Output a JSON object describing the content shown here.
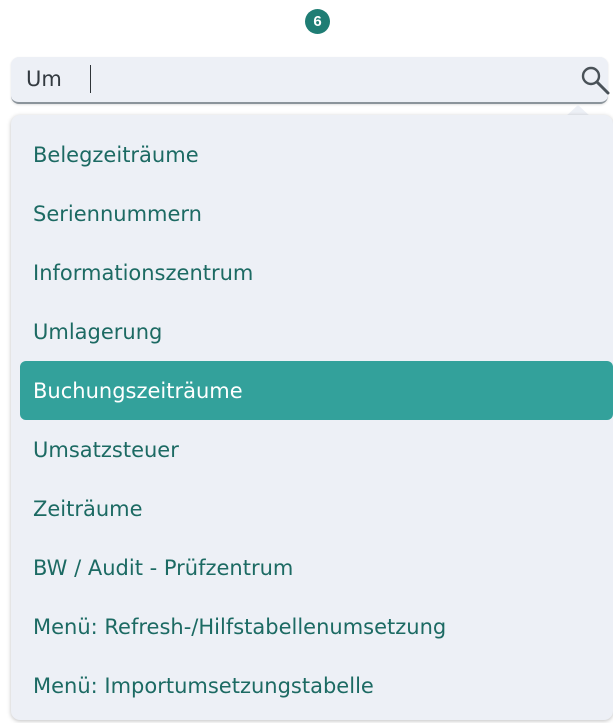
{
  "step_badge": "6",
  "search": {
    "value": "Um",
    "icon": "search-icon"
  },
  "results": [
    {
      "label": "Belegzeiträume",
      "selected": false
    },
    {
      "label": "Seriennummern",
      "selected": false
    },
    {
      "label": "Informationszentrum",
      "selected": false
    },
    {
      "label": "Umlagerung",
      "selected": false
    },
    {
      "label": "Buchungszeiträume",
      "selected": true
    },
    {
      "label": "Umsatzsteuer",
      "selected": false
    },
    {
      "label": "Zeiträume",
      "selected": false
    },
    {
      "label": "BW / Audit - Prüfzentrum",
      "selected": false
    },
    {
      "label": "Menü: Refresh-/Hilfstabellenumsetzung",
      "selected": false
    },
    {
      "label": "Menü: Importumsetzungstabelle",
      "selected": false
    }
  ],
  "colors": {
    "accent": "#33a19b",
    "badge": "#1f7d74",
    "item_text": "#1c6a63",
    "panel_bg": "#edf0f6"
  }
}
